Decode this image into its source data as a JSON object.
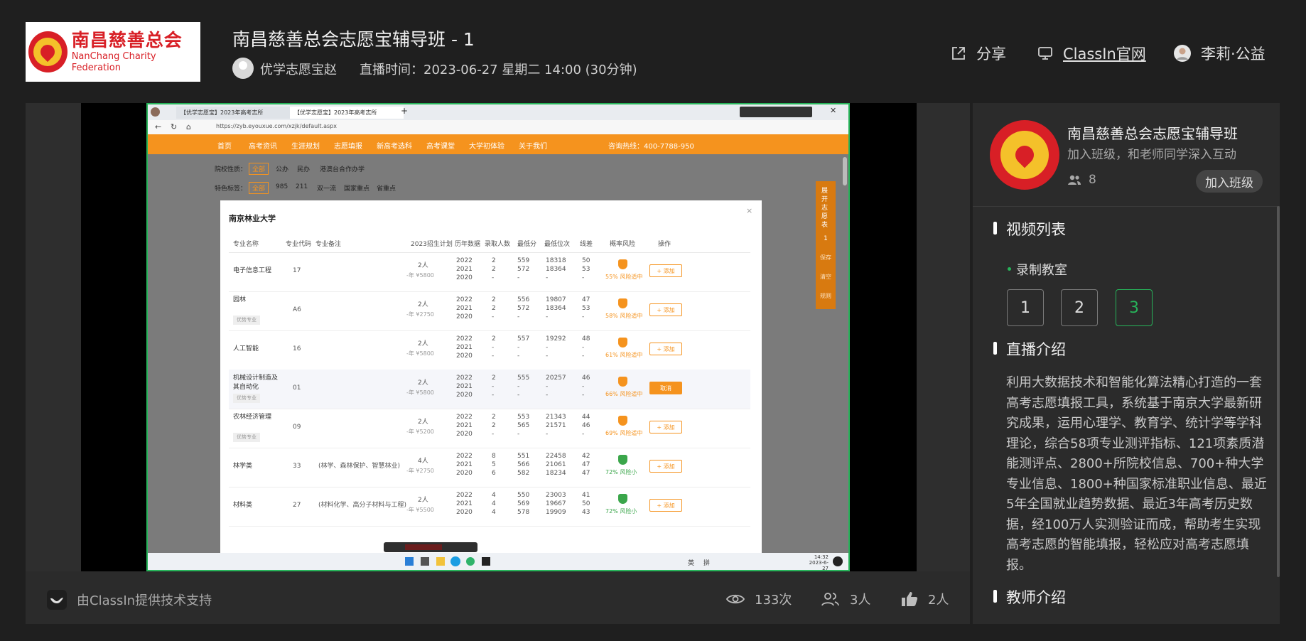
{
  "header": {
    "logo": {
      "cn": "南昌慈善总会",
      "en": "NanChang Charity Federation"
    },
    "title": "南昌慈善总会志愿宝辅导班 - 1",
    "host": "优学志愿宝赵",
    "broadcast_time": "直播时间：2023-06-27 星期二 14:00 (30分钟)",
    "share": "分享",
    "official_site": "ClassIn官网",
    "user": "李莉·公益"
  },
  "footer": {
    "powered_by": "由ClassIn提供技术支持",
    "views": "133次",
    "participants": "3人",
    "likes": "2人"
  },
  "panel": {
    "class_name": "南昌慈善总会志愿宝辅导班",
    "class_desc": "加入班级，和老师同学深入互动",
    "member_count": "8",
    "join_button": "加入班级",
    "video_list_title": "视频列表",
    "recorded_label": "录制教室",
    "videos": [
      "1",
      "2",
      "3"
    ],
    "live_intro_title": "直播介绍",
    "live_intro": "利用大数据技术和智能化算法精心打造的一套高考志愿填报工具，系统基于南京大学最新研究成果，运用心理学、教育学、统计学等学科理论，综合58项专业测评指标、121项素质潜能测评点、2800+所院校信息、700+种大学专业信息、1800+种国家标准职业信息、最近5年全国就业趋势数据、最近3年高考历史数据，经100万人实测验证而成，帮助考生实现高考志愿的智能填报，轻松应对高考志愿填报。",
    "teacher_intro_title": "教师介绍"
  },
  "screen": {
    "tabs": [
      "【优学志愿宝】2023年高考志所",
      "【优学志愿宝】2023年高考志所"
    ],
    "url": "https://zyb.eyouxue.com/xzjk/default.aspx",
    "nav": [
      "首页",
      "高考资讯",
      "生涯规划",
      "志愿填报",
      "新高考选科",
      "高考课堂",
      "大学初体验",
      "关于我们"
    ],
    "hotline": "咨询热线：400-7788-950",
    "filter_school_label": "院校性质：",
    "filter_school": [
      "全部",
      "公办",
      "民办",
      "港澳台合作办学"
    ],
    "filter_tag_label": "特色标签：",
    "filter_tag": [
      "全部",
      "985",
      "211",
      "双一流",
      "国家重点",
      "省重点"
    ],
    "side_panel": [
      "展开志愿表",
      "1",
      "保存",
      "清空",
      "规则"
    ],
    "modal_title": "南京林业大学",
    "columns": [
      "专业名称",
      "专业代码",
      "专业备注",
      "2023招生计划",
      "历年数据",
      "录取人数",
      "最低分",
      "最低位次",
      "线差",
      "概率风险",
      "操作"
    ],
    "rows": [
      {
        "name": "电子信息工程",
        "tag": "",
        "code": "17",
        "note": "",
        "plan": "2人",
        "fee": "-年 ¥5800",
        "years": [
          "2022",
          "2021",
          "2020"
        ],
        "admit": [
          "2",
          "2",
          "-"
        ],
        "min": [
          "559",
          "572",
          "-"
        ],
        "rank": [
          "18318",
          "18364",
          "-"
        ],
        "diff": [
          "50",
          "53",
          "-"
        ],
        "risk": "55% 风险适中",
        "risk_color": "#f5931e",
        "action": "+ 添加"
      },
      {
        "name": "园林",
        "tag": "优势专业",
        "code": "A6",
        "note": "",
        "plan": "2人",
        "fee": "-年 ¥2750",
        "years": [
          "2022",
          "2021",
          "2020"
        ],
        "admit": [
          "2",
          "2",
          "-"
        ],
        "min": [
          "556",
          "572",
          "-"
        ],
        "rank": [
          "19807",
          "18364",
          "-"
        ],
        "diff": [
          "47",
          "53",
          "-"
        ],
        "risk": "58% 风险适中",
        "risk_color": "#f5931e",
        "action": "+ 添加"
      },
      {
        "name": "人工智能",
        "tag": "",
        "code": "16",
        "note": "",
        "plan": "2人",
        "fee": "-年 ¥5800",
        "years": [
          "2022",
          "2021",
          "2020"
        ],
        "admit": [
          "2",
          "-",
          "-"
        ],
        "min": [
          "557",
          "-",
          "-"
        ],
        "rank": [
          "19292",
          "-",
          "-"
        ],
        "diff": [
          "48",
          "-",
          "-"
        ],
        "risk": "61% 风险适中",
        "risk_color": "#f5931e",
        "action": "+ 添加"
      },
      {
        "name": "机械设计制造及其自动化",
        "tag": "优势专业",
        "code": "01",
        "note": "",
        "plan": "2人",
        "fee": "-年 ¥5800",
        "years": [
          "2022",
          "2021",
          "2020"
        ],
        "admit": [
          "2",
          "-",
          "-"
        ],
        "min": [
          "555",
          "-",
          "-"
        ],
        "rank": [
          "20257",
          "-",
          "-"
        ],
        "diff": [
          "46",
          "-",
          "-"
        ],
        "risk": "66% 风险适中",
        "risk_color": "#f5931e",
        "action": "取消"
      },
      {
        "name": "农林经济管理",
        "tag": "优势专业",
        "code": "09",
        "note": "",
        "plan": "2人",
        "fee": "-年 ¥5200",
        "years": [
          "2022",
          "2021",
          "2020"
        ],
        "admit": [
          "2",
          "2",
          "-"
        ],
        "min": [
          "553",
          "565",
          "-"
        ],
        "rank": [
          "21343",
          "21571",
          "-"
        ],
        "diff": [
          "44",
          "46",
          "-"
        ],
        "risk": "69% 风险适中",
        "risk_color": "#f5931e",
        "action": "+ 添加"
      },
      {
        "name": "林学类",
        "tag": "",
        "code": "33",
        "note": "(林学、森林保护、智慧林业)",
        "plan": "4人",
        "fee": "-年 ¥2750",
        "years": [
          "2022",
          "2021",
          "2020"
        ],
        "admit": [
          "8",
          "5",
          "6"
        ],
        "min": [
          "551",
          "566",
          "582"
        ],
        "rank": [
          "22458",
          "21061",
          "18234"
        ],
        "diff": [
          "42",
          "47",
          "47"
        ],
        "risk": "72% 风险小",
        "risk_color": "#3aa64a",
        "action": "+ 添加"
      },
      {
        "name": "材料类",
        "tag": "",
        "code": "27",
        "note": "(材料化学、高分子材料与工程)",
        "plan": "2人",
        "fee": "-年 ¥5500",
        "years": [
          "2022",
          "2021",
          "2020"
        ],
        "admit": [
          "4",
          "4",
          "4"
        ],
        "min": [
          "550",
          "569",
          "578"
        ],
        "rank": [
          "23003",
          "19667",
          "19909"
        ],
        "diff": [
          "41",
          "50",
          "43"
        ],
        "risk": "72% 风险小",
        "risk_color": "#3aa64a",
        "action": "+ 添加"
      }
    ],
    "clock_time": "14:32",
    "clock_date": "2023-6-27",
    "tray_lang": "英",
    "tray_ime": "拼"
  }
}
